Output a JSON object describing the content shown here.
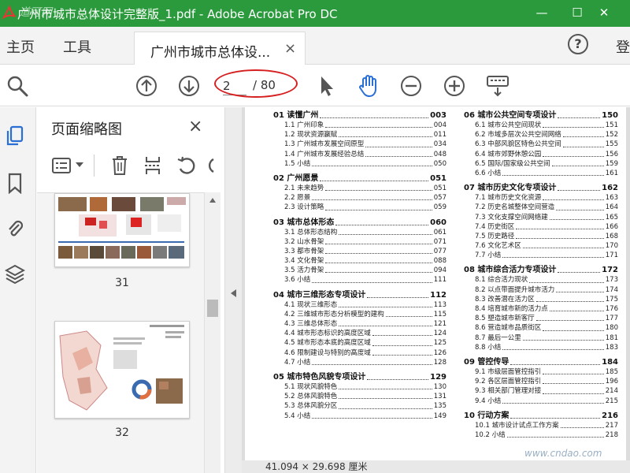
{
  "window": {
    "title": "广州市城市总体设计完整版_1.pdf - Adobe Acrobat Pro DC",
    "minimize": "—",
    "maximize": "☐",
    "close": "✕",
    "colors": {
      "titlebar": "#2a9a3c",
      "accent": "#2a6fd6",
      "annotation": "#d62020"
    }
  },
  "menu": {
    "home": "主页",
    "tools": "工具",
    "doc_tab": "广州市城市总体设...",
    "doc_tab_close": "×",
    "help": "?",
    "login": "登"
  },
  "toolbar": {
    "page_current": "2",
    "page_total": "/ 80",
    "icons": [
      "zoom-search-icon",
      "page-up-icon",
      "page-down-icon",
      "select-arrow-icon",
      "hand-tool-icon",
      "zoom-out-icon",
      "zoom-in-icon",
      "keyboard-icon"
    ]
  },
  "thumbnails": {
    "title": "页面缩略图",
    "close": "×",
    "pages": [
      {
        "label": "31"
      },
      {
        "label": "32"
      }
    ]
  },
  "status": {
    "size": "41.094 × 29.698 厘米"
  },
  "watermark": "www.cndao.com",
  "watermark_top": "道可网",
  "toc": {
    "left": [
      {
        "title": "01 读懂广州",
        "page": "003",
        "items": [
          {
            "t": "1.1 广州印象",
            "p": "004"
          },
          {
            "t": "1.2 现状资源赢赋",
            "p": "011"
          },
          {
            "t": "1.3 广州城市发展空间原型",
            "p": "034"
          },
          {
            "t": "1.4 广州城市发展经验总结",
            "p": "048"
          },
          {
            "t": "1.5 小结",
            "p": "050"
          }
        ]
      },
      {
        "title": "02 广州愿景",
        "page": "051",
        "items": [
          {
            "t": "2.1 未来趋势",
            "p": "051"
          },
          {
            "t": "2.2 愿景",
            "p": "057"
          },
          {
            "t": "2.3 设计策略",
            "p": "059"
          }
        ]
      },
      {
        "title": "03 城市总体形态",
        "page": "060",
        "items": [
          {
            "t": "3.1 总体形态结构",
            "p": "061"
          },
          {
            "t": "3.2 山水骨架",
            "p": "071"
          },
          {
            "t": "3.3 都市骨架",
            "p": "077"
          },
          {
            "t": "3.4 文化骨架",
            "p": "088"
          },
          {
            "t": "3.5 活力骨架",
            "p": "094"
          },
          {
            "t": "3.6 小结",
            "p": "111"
          }
        ]
      },
      {
        "title": "04 城市三维形态专项设计",
        "page": "112",
        "items": [
          {
            "t": "4.1 现状三维形态",
            "p": "113"
          },
          {
            "t": "4.2 三维城市形态分析模型的建构",
            "p": "115"
          },
          {
            "t": "4.3 三维总体形态",
            "p": "121"
          },
          {
            "t": "4.4 城市形态标识的高度区域",
            "p": "124"
          },
          {
            "t": "4.5 城市形态本底的高度区域",
            "p": "125"
          },
          {
            "t": "4.6 限制建设与特别的高度域",
            "p": "126"
          },
          {
            "t": "4.7 小结",
            "p": "128"
          }
        ]
      },
      {
        "title": "05 城市特色风貌专项设计",
        "page": "129",
        "items": [
          {
            "t": "5.1 现状风貌特色",
            "p": "130"
          },
          {
            "t": "5.2 总体风貌特色",
            "p": "131"
          },
          {
            "t": "5.3 总体风貌分区",
            "p": "135"
          },
          {
            "t": "5.4 小结",
            "p": "149"
          }
        ]
      }
    ],
    "right": [
      {
        "title": "06 城市公共空间专项设计",
        "page": "150",
        "items": [
          {
            "t": "6.1 城市公共空间现状",
            "p": "151"
          },
          {
            "t": "6.2 市域多层次公共空间网络",
            "p": "152"
          },
          {
            "t": "6.3 中部风貌区特色公共空间",
            "p": "155"
          },
          {
            "t": "6.4 城市郊野休憩公园",
            "p": "156"
          },
          {
            "t": "6.5 国际/国家级公共空间",
            "p": "159"
          },
          {
            "t": "6.6 小结",
            "p": "161"
          }
        ]
      },
      {
        "title": "07 城市历史文化专项设计",
        "page": "162",
        "items": [
          {
            "t": "7.1 城市历史文化资源",
            "p": "163"
          },
          {
            "t": "7.2 历史名城整体空间营造",
            "p": "164"
          },
          {
            "t": "7.3 文化支撑空间网络建",
            "p": "165"
          },
          {
            "t": "7.4 历史街区",
            "p": "166"
          },
          {
            "t": "7.5 历史路径",
            "p": "168"
          },
          {
            "t": "7.6 文化艺术区",
            "p": "170"
          },
          {
            "t": "7.7 小结",
            "p": "171"
          }
        ]
      },
      {
        "title": "08 城市综合活力专项设计",
        "page": "172",
        "items": [
          {
            "t": "8.1 综合活力现状",
            "p": "173"
          },
          {
            "t": "8.2 以点带面提升城市活力",
            "p": "174"
          },
          {
            "t": "8.3 改善潜在活力区",
            "p": "175"
          },
          {
            "t": "8.4 培育城市新的活力点",
            "p": "176"
          },
          {
            "t": "8.5 塑造城市新客厅",
            "p": "177"
          },
          {
            "t": "8.6 营造城市品质街区",
            "p": "180"
          },
          {
            "t": "8.7 最后一公里",
            "p": "181"
          },
          {
            "t": "8.8 小结",
            "p": "183"
          }
        ]
      },
      {
        "title": "09 管控传导",
        "page": "184",
        "items": [
          {
            "t": "9.1 市级层面管控指引",
            "p": "185"
          },
          {
            "t": "9.2 各区层面管控指引",
            "p": "196"
          },
          {
            "t": "9.3 相关部门管理对接",
            "p": "214"
          },
          {
            "t": "9.4 小结",
            "p": "215"
          }
        ]
      },
      {
        "title": "10 行动方案",
        "page": "216",
        "items": [
          {
            "t": "10.1 城市设计试点工作方案",
            "p": "217"
          },
          {
            "t": "10.2 小结",
            "p": "218"
          }
        ]
      }
    ]
  }
}
